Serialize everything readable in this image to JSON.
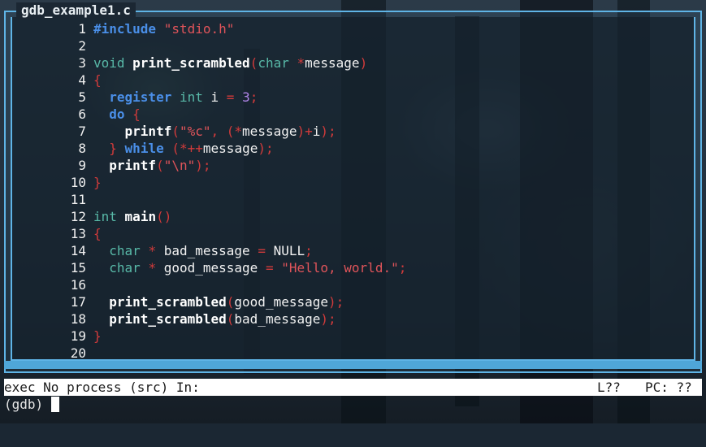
{
  "window": {
    "title": "gdb_example1.c"
  },
  "source": {
    "lines": [
      {
        "n": "1",
        "tokens": [
          {
            "t": "#include",
            "c": "kw"
          },
          {
            "t": " ",
            "c": "text"
          },
          {
            "t": "\"stdio.h\"",
            "c": "str"
          }
        ]
      },
      {
        "n": "2",
        "tokens": []
      },
      {
        "n": "3",
        "tokens": [
          {
            "t": "void",
            "c": "type"
          },
          {
            "t": " ",
            "c": "text"
          },
          {
            "t": "print_scrambled",
            "c": "fn"
          },
          {
            "t": "(",
            "c": "punc"
          },
          {
            "t": "char",
            "c": "type"
          },
          {
            "t": " ",
            "c": "text"
          },
          {
            "t": "*",
            "c": "punc"
          },
          {
            "t": "message",
            "c": "text"
          },
          {
            "t": ")",
            "c": "punc"
          }
        ]
      },
      {
        "n": "4",
        "tokens": [
          {
            "t": "{",
            "c": "punc"
          }
        ]
      },
      {
        "n": "5",
        "tokens": [
          {
            "t": "  ",
            "c": "text"
          },
          {
            "t": "register",
            "c": "kw"
          },
          {
            "t": " ",
            "c": "text"
          },
          {
            "t": "int",
            "c": "type"
          },
          {
            "t": " i ",
            "c": "text"
          },
          {
            "t": "=",
            "c": "punc"
          },
          {
            "t": " ",
            "c": "text"
          },
          {
            "t": "3",
            "c": "num"
          },
          {
            "t": ";",
            "c": "punc"
          }
        ]
      },
      {
        "n": "6",
        "tokens": [
          {
            "t": "  ",
            "c": "text"
          },
          {
            "t": "do",
            "c": "kw"
          },
          {
            "t": " ",
            "c": "text"
          },
          {
            "t": "{",
            "c": "punc"
          }
        ]
      },
      {
        "n": "7",
        "tokens": [
          {
            "t": "    ",
            "c": "text"
          },
          {
            "t": "printf",
            "c": "fn"
          },
          {
            "t": "(",
            "c": "punc"
          },
          {
            "t": "\"%c\"",
            "c": "str"
          },
          {
            "t": ", ",
            "c": "punc"
          },
          {
            "t": "(",
            "c": "punc"
          },
          {
            "t": "*",
            "c": "punc"
          },
          {
            "t": "message",
            "c": "text"
          },
          {
            "t": ")",
            "c": "punc"
          },
          {
            "t": "+",
            "c": "punc"
          },
          {
            "t": "i",
            "c": "text"
          },
          {
            "t": ");",
            "c": "punc"
          }
        ]
      },
      {
        "n": "8",
        "tokens": [
          {
            "t": "  ",
            "c": "text"
          },
          {
            "t": "}",
            "c": "punc"
          },
          {
            "t": " ",
            "c": "text"
          },
          {
            "t": "while",
            "c": "kw"
          },
          {
            "t": " ",
            "c": "text"
          },
          {
            "t": "(",
            "c": "punc"
          },
          {
            "t": "*++",
            "c": "punc"
          },
          {
            "t": "message",
            "c": "text"
          },
          {
            "t": ");",
            "c": "punc"
          }
        ]
      },
      {
        "n": "9",
        "tokens": [
          {
            "t": "  ",
            "c": "text"
          },
          {
            "t": "printf",
            "c": "fn"
          },
          {
            "t": "(",
            "c": "punc"
          },
          {
            "t": "\"\\n\"",
            "c": "str"
          },
          {
            "t": ");",
            "c": "punc"
          }
        ]
      },
      {
        "n": "10",
        "tokens": [
          {
            "t": "}",
            "c": "punc"
          }
        ]
      },
      {
        "n": "11",
        "tokens": []
      },
      {
        "n": "12",
        "tokens": [
          {
            "t": "int",
            "c": "type"
          },
          {
            "t": " ",
            "c": "text"
          },
          {
            "t": "main",
            "c": "fn"
          },
          {
            "t": "()",
            "c": "punc"
          }
        ]
      },
      {
        "n": "13",
        "tokens": [
          {
            "t": "{",
            "c": "punc"
          }
        ]
      },
      {
        "n": "14",
        "tokens": [
          {
            "t": "  ",
            "c": "text"
          },
          {
            "t": "char",
            "c": "type"
          },
          {
            "t": " ",
            "c": "text"
          },
          {
            "t": "*",
            "c": "punc"
          },
          {
            "t": " bad_message ",
            "c": "text"
          },
          {
            "t": "=",
            "c": "punc"
          },
          {
            "t": " NULL",
            "c": "text"
          },
          {
            "t": ";",
            "c": "punc"
          }
        ]
      },
      {
        "n": "15",
        "tokens": [
          {
            "t": "  ",
            "c": "text"
          },
          {
            "t": "char",
            "c": "type"
          },
          {
            "t": " ",
            "c": "text"
          },
          {
            "t": "*",
            "c": "punc"
          },
          {
            "t": " good_message ",
            "c": "text"
          },
          {
            "t": "=",
            "c": "punc"
          },
          {
            "t": " ",
            "c": "text"
          },
          {
            "t": "\"Hello, world.\"",
            "c": "str"
          },
          {
            "t": ";",
            "c": "punc"
          }
        ]
      },
      {
        "n": "16",
        "tokens": []
      },
      {
        "n": "17",
        "tokens": [
          {
            "t": "  ",
            "c": "text"
          },
          {
            "t": "print_scrambled",
            "c": "fn"
          },
          {
            "t": "(",
            "c": "punc"
          },
          {
            "t": "good_message",
            "c": "text"
          },
          {
            "t": ");",
            "c": "punc"
          }
        ]
      },
      {
        "n": "18",
        "tokens": [
          {
            "t": "  ",
            "c": "text"
          },
          {
            "t": "print_scrambled",
            "c": "fn"
          },
          {
            "t": "(",
            "c": "punc"
          },
          {
            "t": "bad_message",
            "c": "text"
          },
          {
            "t": ");",
            "c": "punc"
          }
        ]
      },
      {
        "n": "19",
        "tokens": [
          {
            "t": "}",
            "c": "punc"
          }
        ]
      },
      {
        "n": "20",
        "tokens": []
      }
    ]
  },
  "status": {
    "left": "exec No process (src) In:",
    "line": "L??",
    "pc": "PC: ??"
  },
  "console": {
    "prompt": "(gdb) ",
    "input_value": ""
  },
  "colors": {
    "frame": "#5fb4e6",
    "keyword": "#4a8fe8",
    "type": "#58b9a8",
    "string": "#e0545a",
    "punctuation": "#d23b3b",
    "number": "#b085e8"
  }
}
